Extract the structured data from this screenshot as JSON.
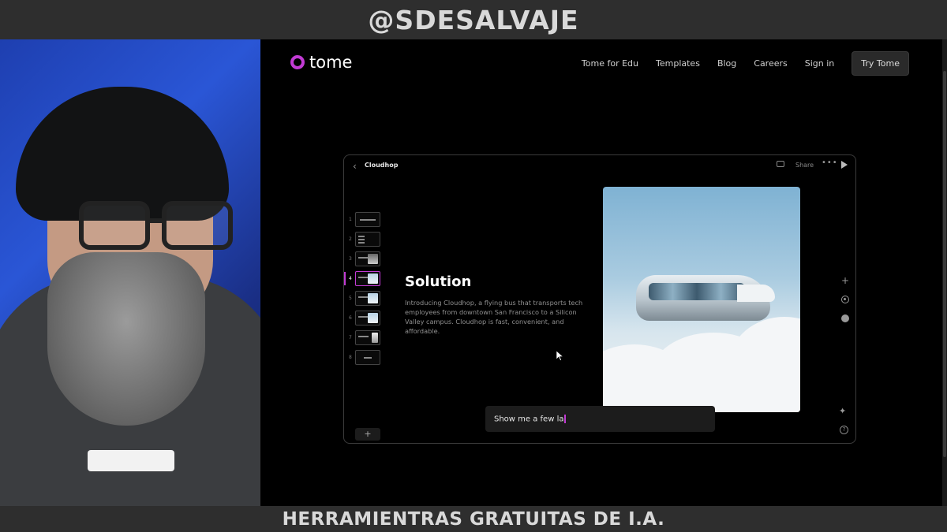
{
  "overlay": {
    "top_banner": "@SDESALVAJE",
    "bottom_banner": "HERRAMIENTRAS GRATUITAS DE I.A."
  },
  "site": {
    "logo_text": "tome",
    "nav": [
      "Tome for Edu",
      "Templates",
      "Blog",
      "Careers",
      "Sign in"
    ],
    "cta": "Try Tome",
    "accent_color": "#c23bd4"
  },
  "app": {
    "doc_title": "Cloudhop",
    "share_label": "Share",
    "thumbnails": [
      {
        "num": "1",
        "active": false
      },
      {
        "num": "2",
        "active": false
      },
      {
        "num": "3",
        "active": false
      },
      {
        "num": "4",
        "active": true
      },
      {
        "num": "5",
        "active": false
      },
      {
        "num": "6",
        "active": false
      },
      {
        "num": "7",
        "active": false
      },
      {
        "num": "8",
        "active": false
      }
    ],
    "add_page_label": "+",
    "slide": {
      "title": "Solution",
      "body": "Introducing Cloudhop, a flying bus that transports tech employees from downtown San Francisco to a Silicon Valley campus. Cloudhop is fast, convenient, and affordable."
    },
    "prompt": {
      "value": "Show me a few la"
    }
  },
  "icons": {
    "back": "chevron-left-icon",
    "comment": "comment-icon",
    "more": "more-icon",
    "play": "play-icon",
    "add": "plus-icon",
    "record": "record-icon",
    "palette": "palette-icon",
    "sparkle": "sparkle-icon",
    "help": "help-icon"
  }
}
